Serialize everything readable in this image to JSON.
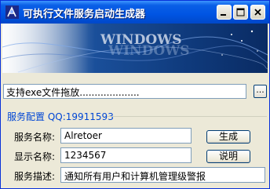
{
  "window": {
    "title": "可执行文件服务启动生成器"
  },
  "banner": {
    "logo_text": "WINDOWS",
    "logo_reflection": "WINDOWS"
  },
  "drop": {
    "value": "支持exe文件拖放....................",
    "browse_label": "..."
  },
  "group": {
    "title": "服务配置  QQ:19911593"
  },
  "form": {
    "service_name_label": "服务名称:",
    "service_name_value": "Alretoer",
    "display_name_label": "显示名称:",
    "display_name_value": "1234567",
    "description_label": "服务描述:",
    "description_value": "通知所有用户和计算机管理级警报"
  },
  "buttons": {
    "generate_label": "生成",
    "help_label": "说明"
  },
  "colors": {
    "titlebar": "#0054e3",
    "group_title": "#0046d5",
    "window_bg": "#ece9d8"
  }
}
